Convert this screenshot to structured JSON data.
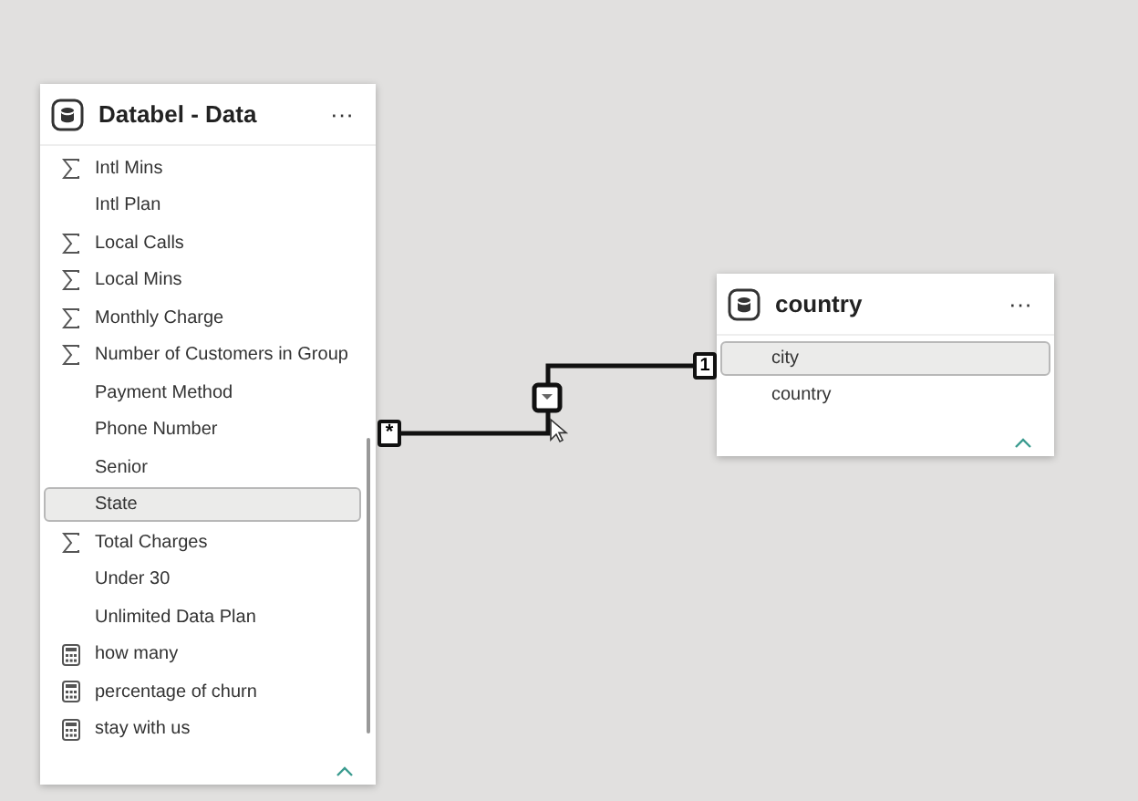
{
  "tables": [
    {
      "title": "Databel - Data",
      "menu": "···",
      "fields": [
        {
          "label": "Intl Mins",
          "kind": "measure",
          "selected": false
        },
        {
          "label": "Intl Plan",
          "kind": "plain",
          "selected": false
        },
        {
          "label": "Local Calls",
          "kind": "measure",
          "selected": false
        },
        {
          "label": "Local Mins",
          "kind": "measure",
          "selected": false
        },
        {
          "label": "Monthly Charge",
          "kind": "measure",
          "selected": false
        },
        {
          "label": "Number of Customers in Group",
          "kind": "measure",
          "selected": false
        },
        {
          "label": "Payment Method",
          "kind": "plain",
          "selected": false
        },
        {
          "label": "Phone Number",
          "kind": "plain",
          "selected": false
        },
        {
          "label": "Senior",
          "kind": "plain",
          "selected": false
        },
        {
          "label": "State",
          "kind": "plain",
          "selected": true
        },
        {
          "label": "Total Charges",
          "kind": "measure",
          "selected": false
        },
        {
          "label": "Under 30",
          "kind": "plain",
          "selected": false
        },
        {
          "label": "Unlimited Data Plan",
          "kind": "plain",
          "selected": false
        },
        {
          "label": "how many",
          "kind": "calc",
          "selected": false
        },
        {
          "label": "percentage of churn",
          "kind": "calc",
          "selected": false
        },
        {
          "label": "stay with us",
          "kind": "calc",
          "selected": false
        }
      ]
    },
    {
      "title": "country",
      "menu": "···",
      "fields": [
        {
          "label": "city",
          "kind": "plain",
          "selected": true
        },
        {
          "label": "country",
          "kind": "plain",
          "selected": false
        }
      ]
    }
  ],
  "relationship": {
    "many_marker": "*",
    "one_marker": "1"
  }
}
